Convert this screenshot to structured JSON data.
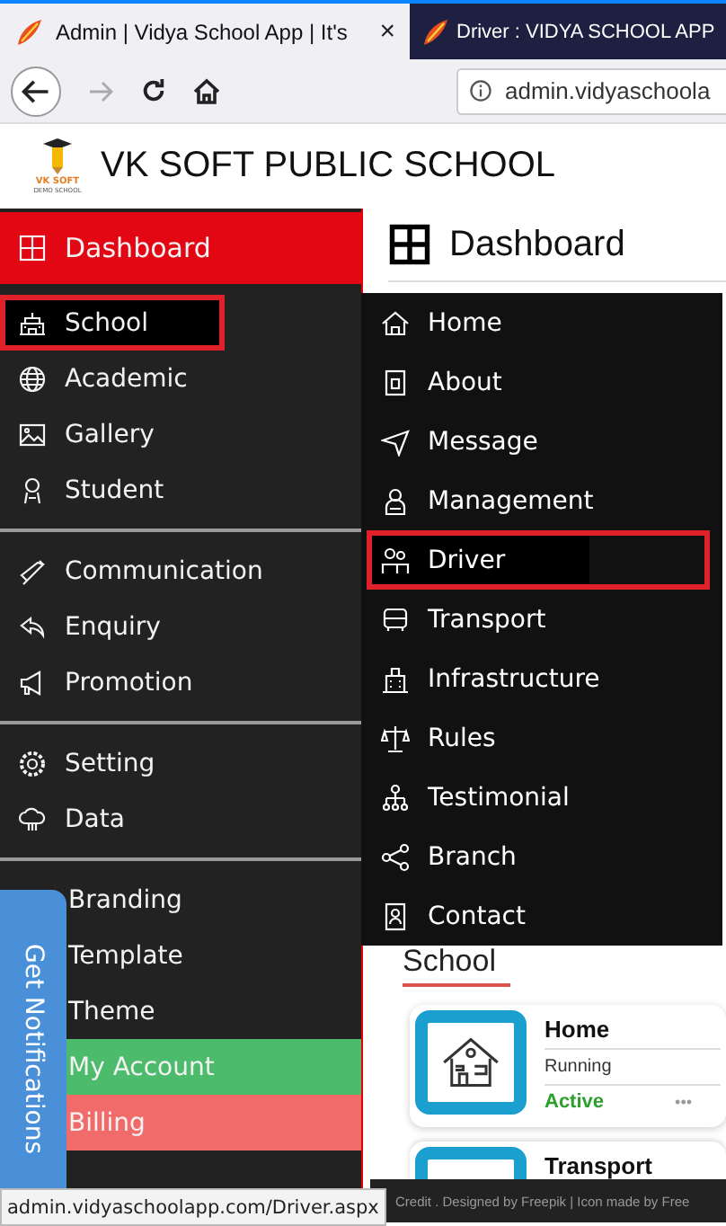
{
  "browser": {
    "tabs": [
      {
        "title": "Admin | Vidya School App | It's",
        "selected": true,
        "close": "×"
      },
      {
        "title": "Driver : VIDYA SCHOOL APP",
        "selected": false
      }
    ],
    "address": "admin.vidyaschoola",
    "status_url": "admin.vidyaschoolapp.com/Driver.aspx"
  },
  "header": {
    "logo_text": "VK SOFT",
    "logo_subtext": "DEMO SCHOOL",
    "school_name": "VK SOFT PUBLIC SCHOOL"
  },
  "sidebar": {
    "groups": [
      [
        {
          "label": "Dashboard",
          "kind": "title",
          "color": "#e30613",
          "selected": false
        },
        {
          "label": "School",
          "kind": "link",
          "selected": true
        },
        {
          "label": "Academic",
          "kind": "link",
          "selected": false
        },
        {
          "label": "Gallery",
          "kind": "link",
          "selected": false
        },
        {
          "label": "Student",
          "kind": "link",
          "selected": false
        }
      ],
      [
        {
          "label": "Communication",
          "kind": "link",
          "selected": false
        },
        {
          "label": "Enquiry",
          "kind": "link",
          "selected": false
        },
        {
          "label": "Promotion",
          "kind": "link",
          "selected": false
        }
      ],
      [
        {
          "label": "Setting",
          "kind": "link",
          "selected": false
        },
        {
          "label": "Data",
          "kind": "link",
          "selected": false
        }
      ],
      [
        {
          "label": "Branding",
          "kind": "link",
          "selected": false
        },
        {
          "label": "Template",
          "kind": "link",
          "selected": false
        },
        {
          "label": "Theme",
          "kind": "link",
          "selected": false
        },
        {
          "label": "My Account",
          "kind": "link",
          "color": "#4cbb6c",
          "selected": false
        },
        {
          "label": "Billing",
          "kind": "link",
          "color": "#f26b6b",
          "selected": false
        }
      ]
    ]
  },
  "submenu": {
    "items": [
      {
        "label": "Home",
        "selected": false
      },
      {
        "label": "About",
        "selected": false
      },
      {
        "label": "Message",
        "selected": false
      },
      {
        "label": "Management",
        "selected": false
      },
      {
        "label": "Driver",
        "selected": true
      },
      {
        "label": "Transport",
        "selected": false
      },
      {
        "label": "Infrastructure",
        "selected": false
      },
      {
        "label": "Rules",
        "selected": false
      },
      {
        "label": "Testimonial",
        "selected": false
      },
      {
        "label": "Branch",
        "selected": false
      },
      {
        "label": "Contact",
        "selected": false
      }
    ]
  },
  "main": {
    "title": "Dashboard",
    "section": "School",
    "cards": [
      {
        "title": "Home",
        "status": "Running",
        "state": "Active",
        "more": "•••"
      },
      {
        "title": "Transport"
      }
    ]
  },
  "footer": "Credit . Designed by Freepik | Icon made by Free",
  "notification_tab": "Get Notifications"
}
